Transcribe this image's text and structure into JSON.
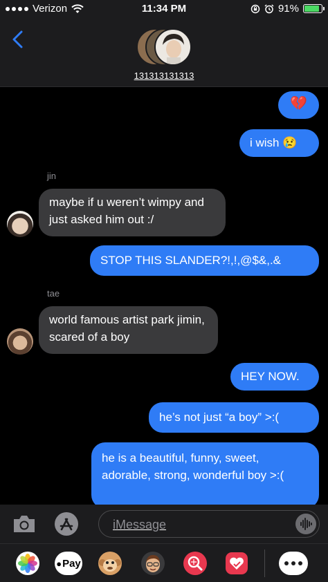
{
  "status_bar": {
    "carrier": "Verizon",
    "time": "11:34 PM",
    "battery": "91%",
    "battery_level": 0.91
  },
  "header": {
    "group_name": "131313131313"
  },
  "messages": [
    {
      "text": "💔"
    },
    {
      "text": "i wish 😢"
    },
    {
      "sender": "jin",
      "text": "maybe if u weren’t wimpy and just asked him out :/"
    },
    {
      "text": "STOP THIS SLANDER?!,!,@$&,.&"
    },
    {
      "sender": "tae",
      "text": "world famous artist park jimin, scared of a boy"
    },
    {
      "text": "HEY NOW."
    },
    {
      "text": "he’s not just “a boy” >:("
    },
    {
      "text": "he is a beautiful, funny, sweet, adorable, strong, wonderful boy >:("
    }
  ],
  "composer": {
    "placeholder": "iMessage"
  },
  "app_drawer": {
    "apple_pay_label": "Pay"
  },
  "colors": {
    "outgoing": "#2f7cf6",
    "incoming": "#3a3a3c",
    "background": "#000000",
    "bar": "#1c1c1e"
  }
}
